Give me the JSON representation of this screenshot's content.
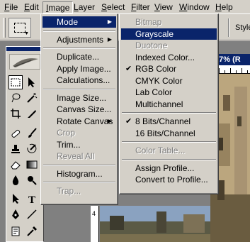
{
  "menubar": {
    "items": [
      {
        "label": "File",
        "ul": "F",
        "rest": "ile"
      },
      {
        "label": "Edit",
        "ul": "E",
        "rest": "dit"
      },
      {
        "label": "Image",
        "ul": "I",
        "rest": "mage"
      },
      {
        "label": "Layer",
        "ul": "L",
        "rest": "ayer"
      },
      {
        "label": "Select",
        "ul": "S",
        "rest": "elect"
      },
      {
        "label": "Filter",
        "ul": "F",
        "rest": "ilter"
      },
      {
        "label": "View",
        "ul": "V",
        "rest": "iew"
      },
      {
        "label": "Window",
        "ul": "W",
        "rest": "indow"
      },
      {
        "label": "Help",
        "ul": "H",
        "rest": "elp"
      }
    ]
  },
  "options_bar": {
    "right_1": "d",
    "right_2": "Style"
  },
  "document": {
    "title": "6.7% (R",
    "ruler_left_label": "4",
    "ruler_top_label": "4"
  },
  "image_menu": [
    {
      "type": "item",
      "label": "Mode",
      "submenu": true,
      "highlighted": true
    },
    {
      "type": "sep"
    },
    {
      "type": "item",
      "label": "Adjustments",
      "submenu": true
    },
    {
      "type": "sep"
    },
    {
      "type": "item",
      "label": "Duplicate..."
    },
    {
      "type": "item",
      "label": "Apply Image..."
    },
    {
      "type": "item",
      "label": "Calculations..."
    },
    {
      "type": "sep"
    },
    {
      "type": "item",
      "label": "Image Size..."
    },
    {
      "type": "item",
      "label": "Canvas Size..."
    },
    {
      "type": "item",
      "label": "Rotate Canvas",
      "submenu": true
    },
    {
      "type": "item",
      "label": "Crop",
      "disabled": true
    },
    {
      "type": "item",
      "label": "Trim..."
    },
    {
      "type": "item",
      "label": "Reveal All",
      "disabled": true
    },
    {
      "type": "sep"
    },
    {
      "type": "item",
      "label": "Histogram..."
    },
    {
      "type": "sep"
    },
    {
      "type": "item",
      "label": "Trap...",
      "disabled": true
    }
  ],
  "mode_menu": [
    {
      "type": "item",
      "label": "Bitmap",
      "disabled": true
    },
    {
      "type": "item",
      "label": "Grayscale",
      "highlighted": true
    },
    {
      "type": "item",
      "label": "Duotone",
      "disabled": true
    },
    {
      "type": "item",
      "label": "Indexed Color..."
    },
    {
      "type": "item",
      "label": "RGB Color",
      "checked": true
    },
    {
      "type": "item",
      "label": "CMYK Color"
    },
    {
      "type": "item",
      "label": "Lab Color"
    },
    {
      "type": "item",
      "label": "Multichannel"
    },
    {
      "type": "sep"
    },
    {
      "type": "item",
      "label": "8 Bits/Channel",
      "checked": true
    },
    {
      "type": "item",
      "label": "16 Bits/Channel"
    },
    {
      "type": "sep"
    },
    {
      "type": "item",
      "label": "Color Table...",
      "disabled": true
    },
    {
      "type": "sep"
    },
    {
      "type": "item",
      "label": "Assign Profile..."
    },
    {
      "type": "item",
      "label": "Convert to Profile..."
    }
  ],
  "colors": {
    "highlight": "#0a246a",
    "face": "#d4d0c8",
    "disabled": "#808080"
  }
}
